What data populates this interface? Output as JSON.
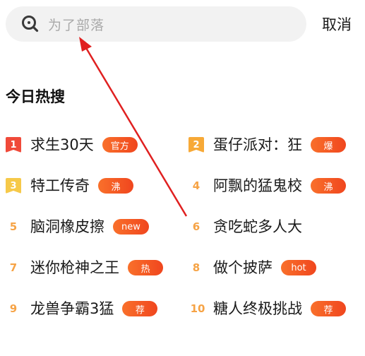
{
  "search": {
    "placeholder": "为了部落",
    "cancel_label": "取消"
  },
  "section": {
    "title": "今日热搜"
  },
  "trending": [
    {
      "rank": "1",
      "title": "求生30天",
      "tag": "官方"
    },
    {
      "rank": "2",
      "title": "蛋仔派对：狂",
      "tag": "爆"
    },
    {
      "rank": "3",
      "title": "特工传奇",
      "tag": "沸"
    },
    {
      "rank": "4",
      "title": "阿飘的猛鬼校",
      "tag": "沸"
    },
    {
      "rank": "5",
      "title": "脑洞橡皮擦",
      "tag": "new"
    },
    {
      "rank": "6",
      "title": "贪吃蛇多人大",
      "tag": ""
    },
    {
      "rank": "7",
      "title": "迷你枪神之王",
      "tag": "热"
    },
    {
      "rank": "8",
      "title": "做个披萨",
      "tag": "hot"
    },
    {
      "rank": "9",
      "title": "龙兽争霸3猛",
      "tag": "荐"
    },
    {
      "rank": "10",
      "title": "糖人终极挑战",
      "tag": "荐"
    }
  ],
  "colors": {
    "rank_1": "#f04a3a",
    "rank_2": "#f7a937",
    "rank_3": "#f6c949",
    "rank_other": "#f6a345",
    "tag_gradient_start": "#f9702b",
    "tag_gradient_end": "#f0461e",
    "annotation_arrow": "#e02020"
  },
  "icons": {
    "search": "search-icon"
  }
}
